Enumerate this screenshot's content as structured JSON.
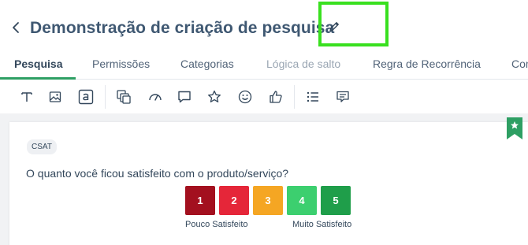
{
  "header": {
    "title": "Demonstração de criação de pesquisa",
    "back_icon": "chevron-left-icon",
    "edit_icon": "pencil-icon",
    "highlight_color": "#39e01f"
  },
  "tabs": [
    {
      "label": "Pesquisa",
      "state": "active"
    },
    {
      "label": "Permissões",
      "state": "normal"
    },
    {
      "label": "Categorias",
      "state": "normal"
    },
    {
      "label": "Lógica de salto",
      "state": "disabled"
    },
    {
      "label": "Regra de Recorrência",
      "state": "normal"
    },
    {
      "label": "Con",
      "state": "normal"
    }
  ],
  "toolbar": {
    "tools": [
      "text-icon",
      "image-icon",
      "answer-text-icon",
      "multiple-choice-icon",
      "gauge-icon",
      "comment-icon",
      "star-icon",
      "smiley-icon",
      "thumbs-up-icon",
      "list-icon",
      "message-icon"
    ]
  },
  "question": {
    "badge": "CSAT",
    "text": "O quanto você ficou satisfeito com o produto/serviço?",
    "scale": [
      {
        "value": "1",
        "color": "#a3101f"
      },
      {
        "value": "2",
        "color": "#e52639"
      },
      {
        "value": "3",
        "color": "#f5a623"
      },
      {
        "value": "4",
        "color": "#3ccf6f"
      },
      {
        "value": "5",
        "color": "#1f9e4a"
      }
    ],
    "low_label": "Pouco Satisfeito",
    "high_label": "Muito Satisfeito"
  },
  "accent_color": "#2e9f63"
}
